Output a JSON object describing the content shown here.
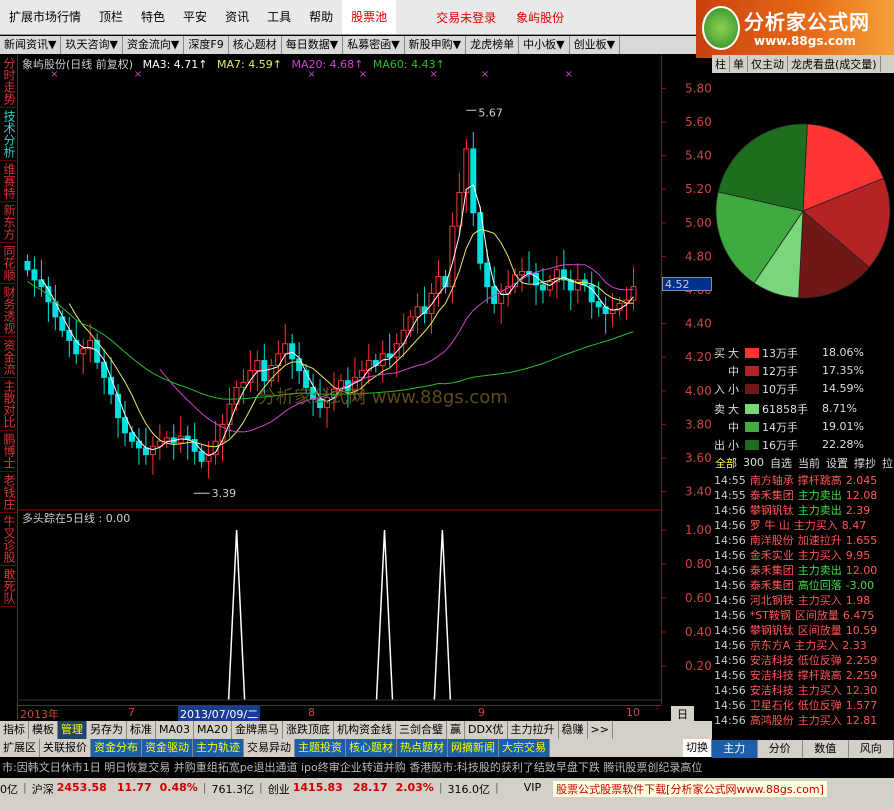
{
  "menubar": {
    "items": [
      "扩展市场行情",
      "顶栏",
      "特色",
      "平安",
      "资讯",
      "工具",
      "帮助"
    ],
    "pool": "股票池",
    "trade_status": "交易未登录",
    "stock_name": "象屿股份"
  },
  "logo": {
    "title": "分析家公式网",
    "url": "www.88gs.com"
  },
  "tabbar": {
    "items": [
      "新闻资讯▼",
      "玖天咨询▼",
      "资金流向▼",
      "深度F9",
      "核心题材",
      "每日数据▼",
      "私募密函▼",
      "新股申购▼",
      "龙虎榜单",
      "中小板▼",
      "创业板▼"
    ]
  },
  "leftbar": {
    "items": [
      "分时走势",
      "技术分析",
      "维赛特",
      "新东方",
      "同花顺",
      "财务透视",
      "资金流",
      "主散对比",
      "鹏博士",
      "老钱庄",
      "牛叉诊股",
      "敢死队"
    ],
    "active_index": 1
  },
  "ma_line": {
    "title": "象屿股份(日线 前复权)",
    "ma3": "MA3: 4.71↑",
    "ma7": "MA7: 4.59↑",
    "ma20": "MA20: 4.68↑",
    "ma60": "MA60: 4.43↑"
  },
  "indicator": {
    "title": "多头踪在5日线 : 0.00"
  },
  "colors": {
    "up": "#ff3232",
    "down": "#00e0e0",
    "ma3": "#ffffff",
    "ma7": "#e8e86a",
    "ma20": "#d040d0",
    "ma60": "#20c020",
    "axis": "#b00000",
    "ind": "#ffffff"
  },
  "chart_data": {
    "type": "candlestick",
    "y_axis": [
      "5.80",
      "5.60",
      "5.40",
      "5.20",
      "5.00",
      "4.80",
      "4.60",
      "4.40",
      "4.20",
      "4.00",
      "3.80",
      "3.60",
      "3.40"
    ],
    "ylim": [
      3.32,
      5.88
    ],
    "ind_axis": [
      "1.00",
      "0.80",
      "0.60",
      "0.40",
      "0.20"
    ],
    "high_label": "5.67",
    "low_label": "3.39",
    "current_price": "4.52",
    "dates": [
      "2013年",
      "7",
      "2013/07/09/二",
      "8",
      "9",
      "10"
    ],
    "period_label": "日线",
    "close": [
      4.72,
      4.66,
      4.62,
      4.53,
      4.44,
      4.36,
      4.3,
      4.22,
      4.25,
      4.3,
      4.17,
      4.08,
      3.98,
      3.84,
      3.75,
      3.7,
      3.66,
      3.62,
      3.67,
      3.7,
      3.72,
      3.69,
      3.73,
      3.71,
      3.64,
      3.58,
      3.62,
      3.7,
      3.8,
      3.92,
      4.02,
      4.05,
      4.12,
      4.18,
      4.06,
      4.15,
      4.22,
      4.28,
      4.19,
      4.12,
      4.02,
      3.95,
      3.9,
      3.96,
      4.01,
      4.06,
      4.0,
      4.08,
      4.12,
      4.18,
      4.15,
      4.22,
      4.2,
      4.28,
      4.36,
      4.44,
      4.5,
      4.46,
      4.58,
      4.68,
      4.62,
      4.98,
      5.18,
      5.44,
      5.06,
      4.76,
      4.62,
      4.52,
      4.58,
      4.62,
      4.69,
      4.71,
      4.7,
      4.63,
      4.6,
      4.65,
      4.72,
      4.66,
      4.6,
      4.66,
      4.63,
      4.53,
      4.5,
      4.46,
      4.48,
      4.52,
      4.54,
      4.62
    ],
    "ind_peaks": [
      0.34,
      0.57,
      0.66
    ],
    "series": [
      {
        "name": "MA3"
      },
      {
        "name": "MA7"
      },
      {
        "name": "MA20"
      },
      {
        "name": "MA60"
      }
    ]
  },
  "right": {
    "tabs": [
      "柱",
      "单",
      "仅主动",
      "龙虎看盘(成交量)"
    ],
    "pie": [
      {
        "v": 18.06,
        "c": "#ff3535"
      },
      {
        "v": 17.35,
        "c": "#b42424"
      },
      {
        "v": 14.59,
        "c": "#701818"
      },
      {
        "v": 8.71,
        "c": "#7ad67a"
      },
      {
        "v": 19.01,
        "c": "#3faa3f"
      },
      {
        "v": 22.28,
        "c": "#1f6e1f"
      }
    ],
    "buy": [
      {
        "side": "买",
        "cat": "大",
        "vol": "13万手",
        "pct": "18.06%"
      },
      {
        "side": "",
        "cat": "中",
        "vol": "12万手",
        "pct": "17.35%"
      },
      {
        "side": "入",
        "cat": "小",
        "vol": "10万手",
        "pct": "14.59%"
      }
    ],
    "sell": [
      {
        "side": "卖",
        "cat": "大",
        "vol": "61858手",
        "pct": "8.71%"
      },
      {
        "side": "",
        "cat": "中",
        "vol": "14万手",
        "pct": "19.01%"
      },
      {
        "side": "出",
        "cat": "小",
        "vol": "16万手",
        "pct": "22.28%"
      }
    ],
    "filter_tabs": [
      "全部",
      "300",
      "自选",
      "当前",
      "设置",
      "撑抄",
      "拉出"
    ],
    "trades": [
      {
        "t": "14:55",
        "n": "南方轴承",
        "e": "撑杆跳高",
        "v": "2.045"
      },
      {
        "t": "14:55",
        "n": "泰禾集团",
        "e": "主力卖出",
        "v": "12.08"
      },
      {
        "t": "14:56",
        "n": "攀钢钒钛",
        "e": "主力卖出",
        "v": "2.39"
      },
      {
        "t": "14:56",
        "n": "罗 牛 山",
        "e": "主力买入",
        "v": "8.47"
      },
      {
        "t": "14:56",
        "n": "南洋股份",
        "e": "加速拉升",
        "v": "1.655"
      },
      {
        "t": "14:56",
        "n": "金禾实业",
        "e": "主力买入",
        "v": "9.95"
      },
      {
        "t": "14:56",
        "n": "泰禾集团",
        "e": "主力卖出",
        "v": "12.00"
      },
      {
        "t": "14:56",
        "n": "泰禾集团",
        "e": "高位回落",
        "v": "-3.00"
      },
      {
        "t": "14:56",
        "n": "河北钢铁",
        "e": "主力买入",
        "v": "1.98"
      },
      {
        "t": "14:56",
        "n": "*ST鞍钢",
        "e": "区间放量",
        "v": "6.475"
      },
      {
        "t": "14:56",
        "n": "攀钢钒钛",
        "e": "区间放量",
        "v": "10.59"
      },
      {
        "t": "14:56",
        "n": "京东方A",
        "e": "主力买入",
        "v": "2.33"
      },
      {
        "t": "14:56",
        "n": "安洁科技",
        "e": "低位反弹",
        "v": "2.259"
      },
      {
        "t": "14:56",
        "n": "安洁科技",
        "e": "撑杆跳高",
        "v": "2.259"
      },
      {
        "t": "14:56",
        "n": "安洁科技",
        "e": "主力买入",
        "v": "12.30"
      },
      {
        "t": "14:56",
        "n": "卫星石化",
        "e": "低位反弹",
        "v": "1.577"
      },
      {
        "t": "14:56",
        "n": "高鸿股份",
        "e": "主力买入",
        "v": "12.81"
      }
    ],
    "bottom_tabs": [
      "主力",
      "分价",
      "数值",
      "风向"
    ]
  },
  "bottomtabs": {
    "items": [
      "指标",
      "模板",
      "管理",
      "另存为",
      "标准",
      "MA03",
      "MA20",
      "金牌黑马",
      "涨跌顶底",
      "机构资金线",
      "三剑合璧",
      "赢",
      "DDX优",
      "主力拉升",
      "稳赚",
      ">>"
    ]
  },
  "bottomtabs2": {
    "items": [
      "扩展区",
      "关联报价",
      "资金分布",
      "资金驱动",
      "主力轨迹",
      "交易异动",
      "主题投资",
      "核心题材",
      "热点题材",
      "网摘新闻",
      "大宗交易"
    ],
    "cut": "切换"
  },
  "ticker": {
    "text": "市:因韩文日休市1日  明日恢复交易     并购重组拓宽pe退出通道  ipo终审企业转道并购     香港股市:科技股的获利了结致早盘下跌  腾讯股票创纪录高位"
  },
  "status": {
    "a": "0亿",
    "sh": "沪深",
    "sh_v": "2453.58",
    "sh_c": "11.77",
    "sh_p": "0.48%",
    "sh_amt": "761.3亿",
    "cy": "创业",
    "cy_v": "1415.83",
    "cy_c": "28.17",
    "cy_p": "2.03%",
    "cy_amt": "316.0亿",
    "vip": "VIP",
    "notice": "股票公式股票软件下载[分析家公式网www.88gs.com]"
  },
  "watermark": "分析家公式网  www.88gs.com"
}
